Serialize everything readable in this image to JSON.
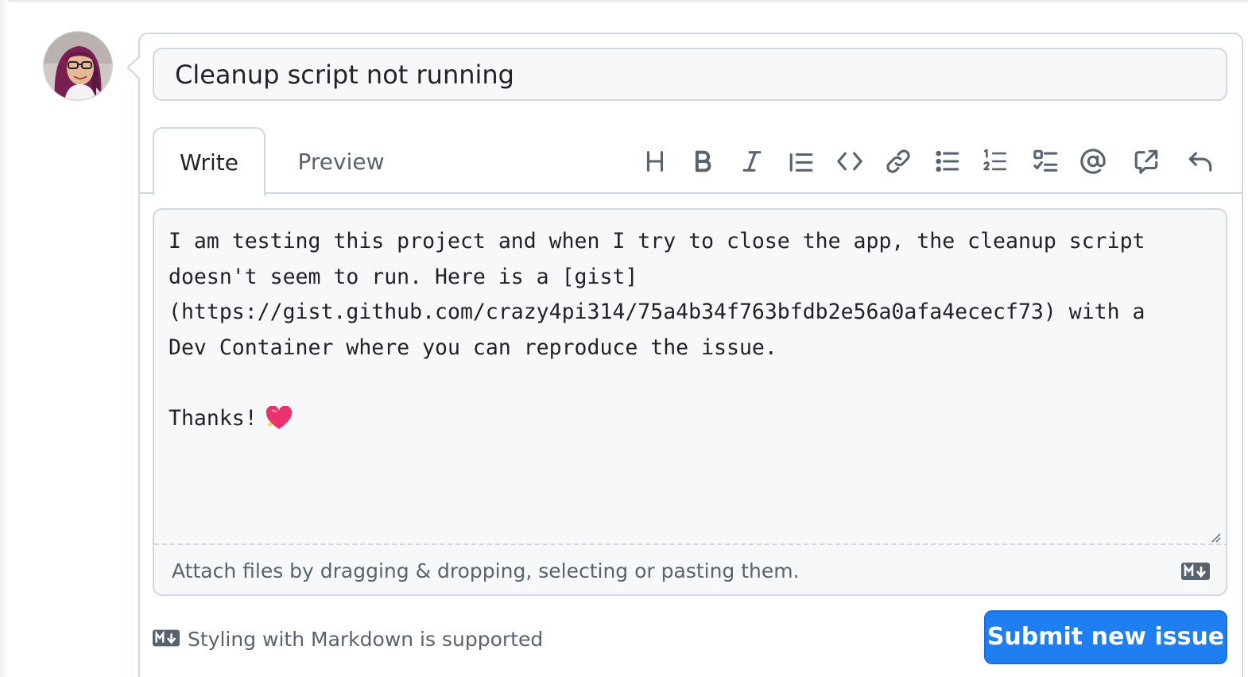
{
  "issue": {
    "title": "Cleanup script not running",
    "body": "I am testing this project and when I try to close the app, the cleanup script\ndoesn't seem to run. Here is a [gist]\n(https://gist.github.com/crazy4pi314/75a4b34f763bfdb2e56a0afa4ececf73) with a\nDev Container where you can reproduce the issue.\n\nThanks!",
    "body_emoji": "heart-sparkle"
  },
  "tabs": [
    {
      "label": "Write",
      "active": true
    },
    {
      "label": "Preview",
      "active": false
    }
  ],
  "toolbar": {
    "icons": [
      "heading-icon",
      "bold-icon",
      "italic-icon",
      "quote-icon",
      "code-icon",
      "link-icon",
      "unordered-list-icon",
      "ordered-list-icon",
      "task-list-icon",
      "mention-icon",
      "reference-icon",
      "undo-icon"
    ]
  },
  "editor": {
    "attach_hint": "Attach files by dragging & dropping, selecting or pasting them."
  },
  "footer": {
    "markdown_note": "Styling with Markdown is supported",
    "submit_label": "Submit new issue"
  },
  "colors": {
    "accent": "#1f7ff0",
    "border": "#d0d7de",
    "muted_text": "#59636e",
    "field_bg": "#f6f8fa"
  }
}
